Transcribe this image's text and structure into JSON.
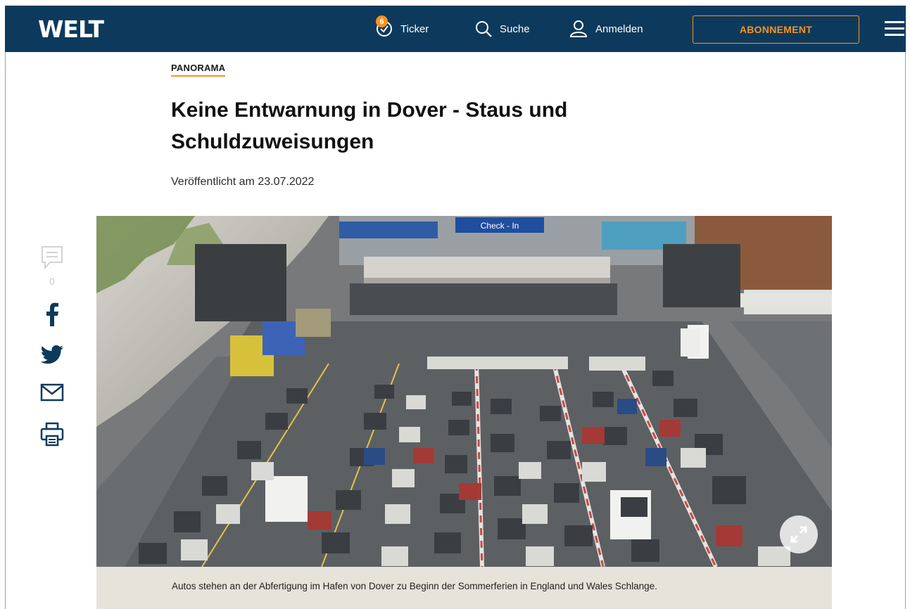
{
  "header": {
    "logo": "WELT",
    "ticker_label": "Ticker",
    "ticker_count": "6",
    "search_label": "Suche",
    "login_label": "Anmelden",
    "subscribe_label": "ABONNEMENT"
  },
  "article": {
    "kicker": "PANORAMA",
    "headline": "Keine Entwarnung in Dover - Staus und Schuldzuweisungen",
    "published": "Veröffentlicht am 23.07.2022",
    "comment_count": "0",
    "image": {
      "sign_text": "Check - In",
      "caption": "Autos stehen an der Abfertigung im Hafen von Dover zu Beginn der Sommerferien in England und Wales Schlange."
    }
  },
  "colors": {
    "header_bg": "#0d3a5c",
    "accent": "#f7941d",
    "caption_bg": "#e6e3db",
    "social_icon": "#0d3a5c"
  },
  "icons": [
    "ticker-clock-icon",
    "search-icon",
    "user-icon",
    "menu-icon",
    "comment-icon",
    "facebook-icon",
    "twitter-icon",
    "mail-icon",
    "print-icon",
    "expand-icon"
  ]
}
